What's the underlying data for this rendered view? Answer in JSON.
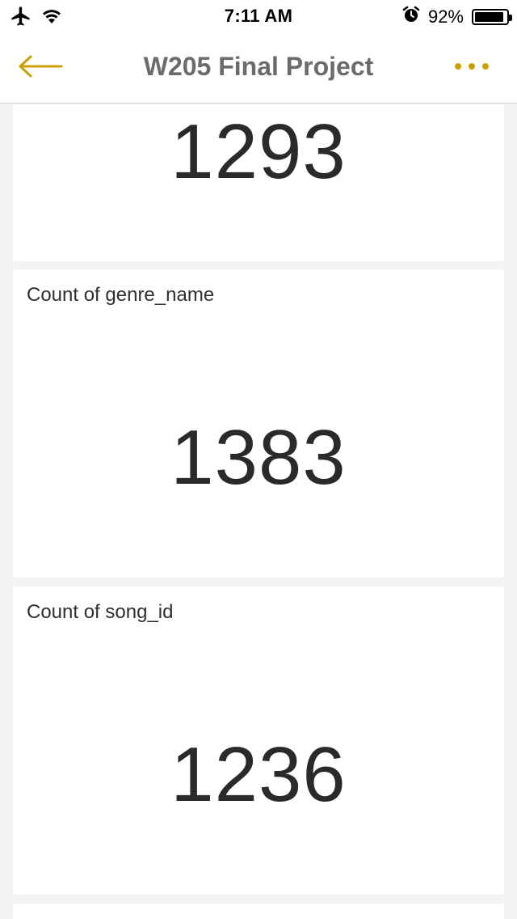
{
  "status_bar": {
    "time": "7:11 AM",
    "battery_percent": "92%",
    "battery_level": 0.92,
    "icons": [
      "airplane-icon",
      "wifi-icon",
      "alarm-icon",
      "battery-icon"
    ]
  },
  "nav": {
    "title": "W205 Final Project",
    "back_icon": "arrow-left-icon",
    "more_icon": "more-dots-icon",
    "accent_color": "#c9a100"
  },
  "cards": [
    {
      "title": "",
      "value": "1293"
    },
    {
      "title": "Count of genre_name",
      "value": "1383"
    },
    {
      "title": "Count of song_id",
      "value": "1236"
    }
  ]
}
